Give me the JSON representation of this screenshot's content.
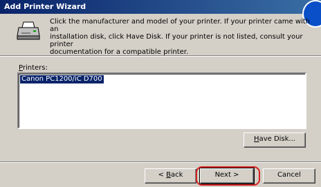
{
  "window": {
    "title": "Add Printer Wizard"
  },
  "intro": {
    "line1": "Click the manufacturer and model of your printer. If your printer came with an",
    "line2": "installation disk, click Have Disk. If your printer is not listed, consult your printer",
    "line3": "documentation for a compatible printer."
  },
  "printers": {
    "label_accel": "P",
    "label_rest": "rinters:",
    "items": [
      "Canon PC1200/iC D700"
    ]
  },
  "buttons": {
    "have_disk_accel": "H",
    "have_disk_rest": "ave Disk...",
    "back_prefix": "< ",
    "back_accel": "B",
    "back_rest": "ack",
    "next": "Next >",
    "cancel": "Cancel"
  },
  "colors": {
    "titlebar": "#0a246a",
    "selection": "#0a246a",
    "highlight_ring": "#d42020",
    "dialog_bg": "#d4d0c8"
  },
  "icons": {
    "header": "printer-icon"
  }
}
